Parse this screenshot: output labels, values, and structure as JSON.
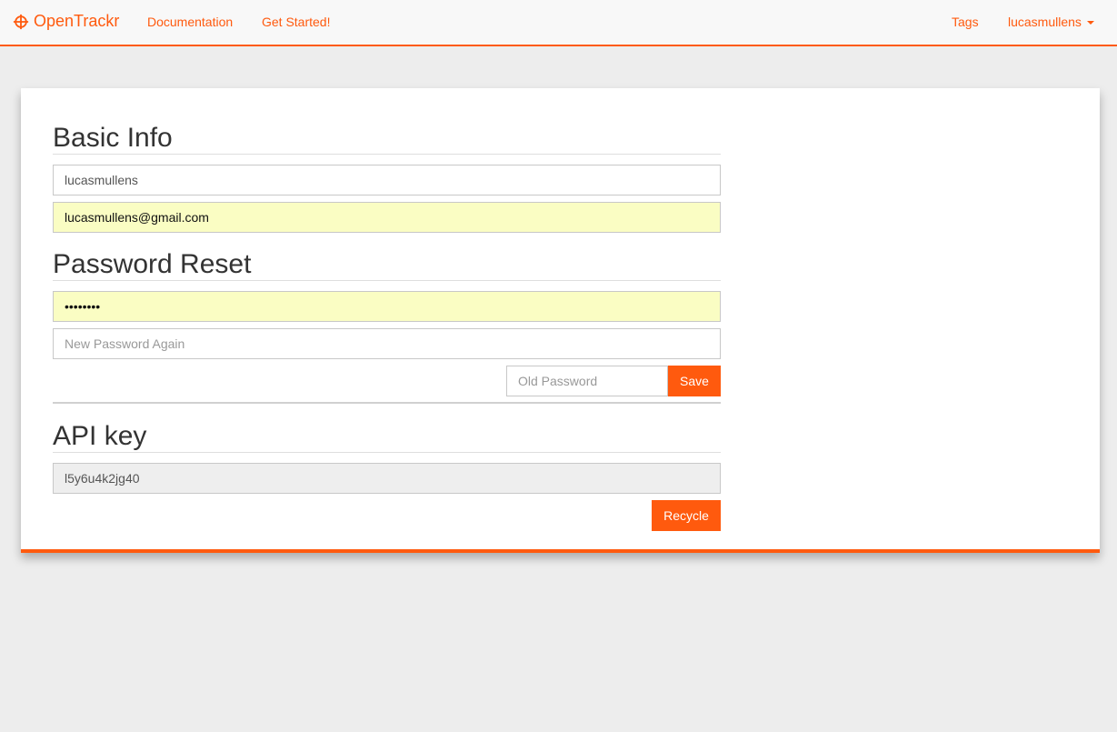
{
  "nav": {
    "brand": "OpenTrackr",
    "links": [
      "Documentation",
      "Get Started!"
    ],
    "right": {
      "tags": "Tags",
      "user": "lucasmullens"
    },
    "accent_color": "#ff5a0e"
  },
  "basic_info": {
    "title": "Basic Info",
    "username": "lucasmullens",
    "email": "lucasmullens@gmail.com"
  },
  "password_reset": {
    "title": "Password Reset",
    "new_password_value": "••••••••",
    "new_password_again_placeholder": "New Password Again",
    "old_password_placeholder": "Old Password",
    "save_label": "Save"
  },
  "api_key": {
    "title": "API key",
    "value": "l5y6u4k2jg40",
    "recycle_label": "Recycle"
  }
}
